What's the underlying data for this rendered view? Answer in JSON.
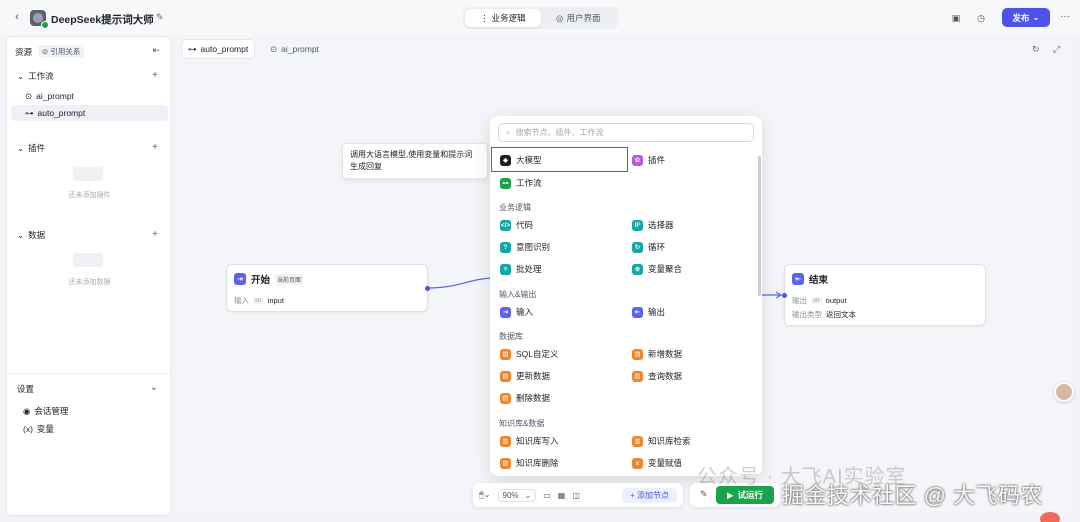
{
  "header": {
    "app_title": "DeepSeek提示词大师",
    "tabs": [
      {
        "label": "业务逻辑"
      },
      {
        "label": "用户界面"
      }
    ],
    "publish_label": "发布"
  },
  "sidebar": {
    "title": "资源",
    "ref_label": "引用关系",
    "sections": [
      {
        "label": "工作流",
        "items": [
          {
            "label": "ai_prompt"
          },
          {
            "label": "auto_prompt"
          }
        ]
      },
      {
        "label": "插件",
        "empty_text": "还未添加插件"
      },
      {
        "label": "数据",
        "empty_text": "还未添加数据"
      }
    ],
    "settings": {
      "label": "设置",
      "items": [
        {
          "label": "会话管理"
        },
        {
          "label": "变量"
        }
      ]
    }
  },
  "canvas": {
    "tabs": [
      {
        "label": "auto_prompt"
      },
      {
        "label": "ai_prompt"
      }
    ],
    "tooltip": "调用大语言模型,使用变量和提示词生成回复",
    "start_node": {
      "title": "开始",
      "tag": "当前页面",
      "field_key": "输入",
      "field_type": "str",
      "field_value": "input"
    },
    "end_node": {
      "title": "结束",
      "output_key": "输出",
      "output_type": "str",
      "output_value": "output",
      "type_key": "输出类型",
      "type_value": "返回文本"
    }
  },
  "node_panel": {
    "search_placeholder": "搜索节点、插件、工作流",
    "top_items": [
      {
        "label": "大模型",
        "icon": "llm-icon",
        "color": "#1d2129"
      },
      {
        "label": "插件",
        "icon": "plugin-icon",
        "color": "#b35ae6"
      },
      {
        "label": "工作流",
        "icon": "workflow-icon",
        "color": "#1aa34a"
      }
    ],
    "categories": [
      {
        "label": "业务逻辑",
        "items": [
          {
            "label": "代码",
            "color": "#17a6a6"
          },
          {
            "label": "选择器",
            "color": "#17a6a6"
          },
          {
            "label": "意图识别",
            "color": "#17a6a6"
          },
          {
            "label": "循环",
            "color": "#17a6a6"
          },
          {
            "label": "批处理",
            "color": "#17a6a6"
          },
          {
            "label": "变量聚合",
            "color": "#17a6a6"
          }
        ]
      },
      {
        "label": "输入&输出",
        "items": [
          {
            "label": "输入",
            "color": "#5b63f0"
          },
          {
            "label": "输出",
            "color": "#5b63f0"
          }
        ]
      },
      {
        "label": "数据库",
        "items": [
          {
            "label": "SQL自定义",
            "color": "#f0852d"
          },
          {
            "label": "新增数据",
            "color": "#f0852d"
          },
          {
            "label": "更新数据",
            "color": "#f0852d"
          },
          {
            "label": "查询数据",
            "color": "#f0852d"
          },
          {
            "label": "删除数据",
            "color": "#f0852d"
          }
        ]
      },
      {
        "label": "知识库&数据",
        "items": [
          {
            "label": "知识库写入",
            "color": "#f0852d"
          },
          {
            "label": "知识库检索",
            "color": "#f0852d"
          },
          {
            "label": "知识库删除",
            "color": "#f0852d"
          },
          {
            "label": "变量赋值",
            "color": "#f0852d"
          }
        ]
      }
    ]
  },
  "toolbar": {
    "zoom": "90%",
    "add_node_label": "添加节点",
    "run_label": "试运行"
  },
  "watermark": {
    "line1": "公众号 · 大飞AI实验室",
    "line2": "掘金技术社区 @ 大飞码农"
  }
}
